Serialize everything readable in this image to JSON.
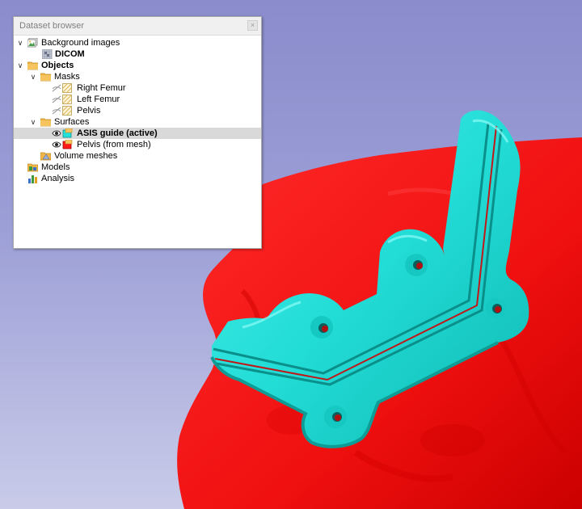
{
  "panel": {
    "title": "Dataset browser",
    "close_glyph": "×"
  },
  "tree": {
    "background_images": "Background images",
    "dicom": "DICOM",
    "objects": "Objects",
    "masks": "Masks",
    "right_femur": "Right Femur",
    "left_femur": "Left Femur",
    "pelvis": "Pelvis",
    "surfaces": "Surfaces",
    "asis_guide": "ASIS guide (active)",
    "pelvis_mesh": "Pelvis (from mesh)",
    "volume_meshes": "Volume meshes",
    "models": "Models",
    "analysis": "Analysis"
  },
  "icons": {
    "expanded": "chevron-down-icon",
    "image_stack": "image-stack-icon",
    "dicom": "dicom-grid-icon",
    "folder": "folder-icon",
    "mask": "mask-icon",
    "visibility": "eye-icon",
    "surface": "surface-icon",
    "mesh": "mesh-icon",
    "models": "models-icon",
    "analysis": "analysis-chart-icon"
  },
  "colors": {
    "bone_surface": "#ff1a1a",
    "guide_surface": "#26e0da",
    "background_top": "#8a8ccc",
    "background_bottom": "#c9cbe9",
    "selection": "#d9d9d9"
  }
}
